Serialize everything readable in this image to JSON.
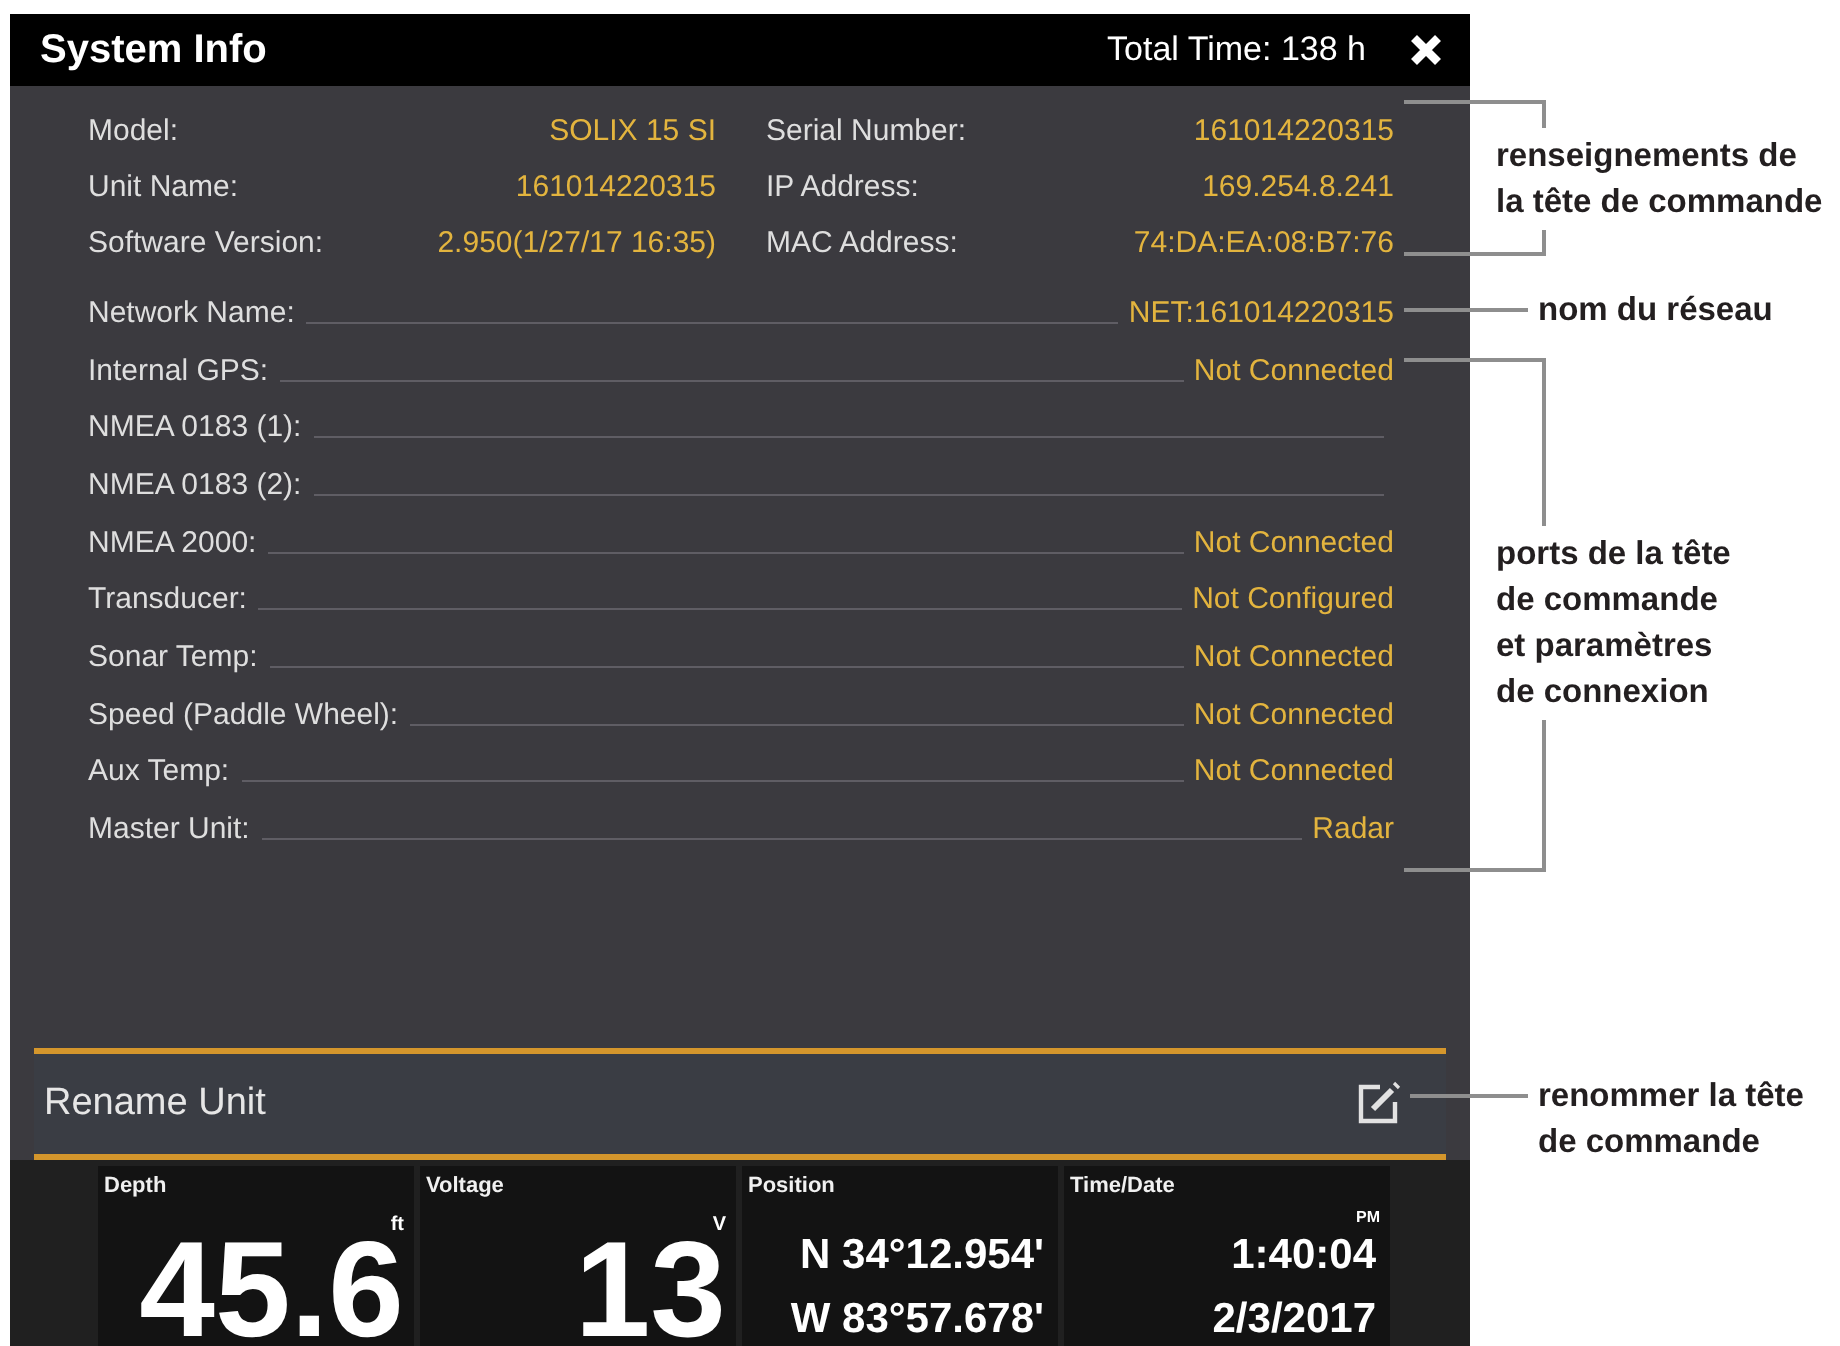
{
  "window": {
    "title": "System Info",
    "total_time": "Total Time: 138 h"
  },
  "unit_info": [
    {
      "label": "Model:",
      "value": "SOLIX 15 SI"
    },
    {
      "label": "Serial Number:",
      "value": "161014220315"
    },
    {
      "label": "Unit Name:",
      "value": "161014220315"
    },
    {
      "label": "IP Address:",
      "value": "169.254.8.241"
    },
    {
      "label": "Software Version:",
      "value": "2.950(1/27/17 16:35)"
    },
    {
      "label": "MAC Address:",
      "value": "74:DA:EA:08:B7:76"
    }
  ],
  "status_rows": [
    {
      "label": "Network Name:",
      "value": "NET:161014220315"
    },
    {
      "label": "Internal GPS:",
      "value": "Not Connected"
    },
    {
      "label": "NMEA 0183 (1):"
    },
    {
      "label": "NMEA 0183 (2):"
    },
    {
      "label": "NMEA 2000:",
      "value": "Not Connected"
    },
    {
      "label": "Transducer:",
      "value": "Not Configured"
    },
    {
      "label": "Sonar Temp:",
      "value": "Not Connected"
    },
    {
      "label": "Speed (Paddle Wheel):",
      "value": "Not Connected"
    },
    {
      "label": "Aux Temp:",
      "value": "Not Connected"
    },
    {
      "label": "Master Unit:",
      "value": "Radar"
    }
  ],
  "rename": {
    "label": "Rename Unit"
  },
  "data_bar": [
    {
      "kind": "single",
      "label": "Depth",
      "value": "45.6",
      "unit": "ft"
    },
    {
      "kind": "single",
      "label": "Voltage",
      "value": "13",
      "unit": "V"
    },
    {
      "kind": "double",
      "label": "Position",
      "lines": [
        "N 34°12.954'",
        "W 83°57.678'"
      ]
    },
    {
      "kind": "double",
      "label": "Time/Date",
      "unit": "PM",
      "lines": [
        "1:40:04",
        "2/3/2017"
      ]
    }
  ],
  "callouts": [
    {
      "kind": "bracket",
      "lines": [
        "renseignements de",
        "la tête de commande"
      ]
    },
    {
      "kind": "line",
      "lines": [
        "nom du réseau"
      ]
    },
    {
      "kind": "bracket",
      "lines": [
        "ports de la tête",
        "de commande",
        "et paramètres",
        "de connexion"
      ]
    },
    {
      "kind": "line",
      "lines": [
        "renommer la tête",
        "de commande"
      ]
    }
  ]
}
